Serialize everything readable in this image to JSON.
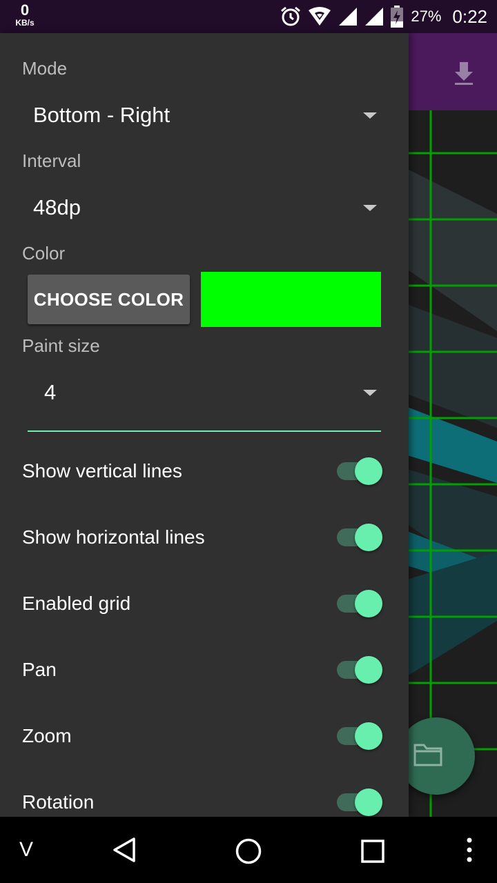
{
  "status_bar": {
    "net_speed_value": "0",
    "net_speed_unit": "KB/s",
    "battery_percent": "27%",
    "time": "0:22",
    "icons": [
      "alarm-icon",
      "wifi-icon",
      "signal-icon",
      "signal-icon",
      "battery-charging-icon"
    ]
  },
  "app_bar": {
    "icon": "download-icon",
    "color": "#4b1a5c"
  },
  "drawer": {
    "mode": {
      "label": "Mode",
      "value": "Bottom - Right"
    },
    "interval": {
      "label": "Interval",
      "value": "48dp"
    },
    "color": {
      "label": "Color",
      "button_label": "CHOOSE COLOR",
      "swatch_color": "#00ff00"
    },
    "paint_size": {
      "label": "Paint size",
      "value": "4"
    },
    "toggles": [
      {
        "label": "Show vertical lines",
        "on": true
      },
      {
        "label": "Show horizontal lines",
        "on": true
      },
      {
        "label": "Enabled grid",
        "on": true
      },
      {
        "label": "Pan",
        "on": true
      },
      {
        "label": "Zoom",
        "on": true
      },
      {
        "label": "Rotation",
        "on": true
      }
    ],
    "accent_color": "#69efad"
  },
  "fab": {
    "icon": "folder-icon"
  },
  "nav_bar": {
    "v_button": "V",
    "icons": [
      "back-icon",
      "home-icon",
      "recents-icon",
      "more-vert-icon"
    ]
  }
}
